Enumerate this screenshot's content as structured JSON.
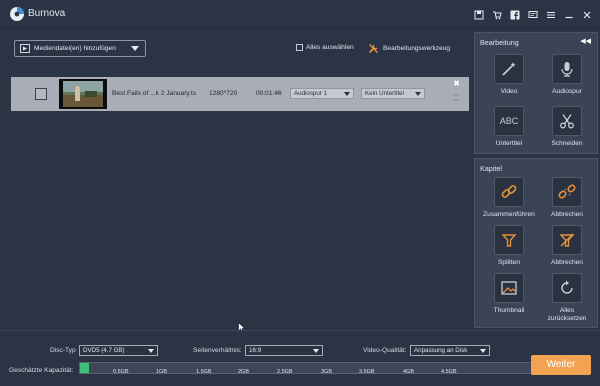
{
  "app": {
    "title": "Burnova"
  },
  "titlebar_icons": [
    "save-icon",
    "shopping-cart-icon",
    "facebook-icon",
    "feedback-icon",
    "menu-icon",
    "minimize-icon",
    "close-icon"
  ],
  "toolbar": {
    "add_media_label": "Mediendatei(en) hinzufügen",
    "select_all_label": "Alles auswählen",
    "edit_tool_label": "Bearbeitungswerkzeug"
  },
  "files": [
    {
      "name": "Best Fails of ...k 2 January.ts",
      "resolution": "1280*720",
      "duration": "00:01:46",
      "audio_track": "Audiospur 1",
      "subtitle": "Kein Untertitel",
      "close_glyph": "✖"
    }
  ],
  "sidebar": {
    "edit_section": {
      "title": "Bearbeitung",
      "collapse_glyph": "◀◀",
      "tools": [
        {
          "label": "Video",
          "icon": "magic-wand-icon"
        },
        {
          "label": "Audiospur",
          "icon": "microphone-icon"
        },
        {
          "label": "Untertitel",
          "icon": "abc-text-icon",
          "glyph": "ABC"
        },
        {
          "label": "Schneiden",
          "icon": "scissors-icon"
        }
      ]
    },
    "chapter_section": {
      "title": "Kapitel",
      "tools": [
        {
          "label": "Zusammenführen",
          "icon": "merge-link-icon"
        },
        {
          "label": "Abbrechen",
          "icon": "unlink-icon"
        },
        {
          "label": "Splitten",
          "icon": "split-icon"
        },
        {
          "label": "Abbrechen",
          "icon": "cancel-split-icon"
        },
        {
          "label": "Thumbnail",
          "icon": "thumbnail-icon"
        },
        {
          "label": "Alles zurücksetzen",
          "icon": "reset-icon"
        }
      ]
    }
  },
  "bottom": {
    "disc_type_label": "Disc-Typ",
    "disc_type_value": "DVD5 (4.7 GB)",
    "aspect_label": "Seitenverhältnis:",
    "aspect_value": "16:9",
    "quality_label": "Video-Qualität:",
    "quality_value": "Anpassung an Disk",
    "capacity_label": "Geschätzte Kapazität:",
    "capacity_used_fraction": 0.02,
    "capacity_ticks": [
      "0.5GB",
      "1GB",
      "1.5GB",
      "2GB",
      "2.5GB",
      "3GB",
      "3.5GB",
      "4GB",
      "4.5GB"
    ],
    "next_label": "Weiter"
  },
  "colors": {
    "accent": "#f2a250",
    "capacity_fill": "#3cbf79",
    "icon_orange": "#e8913a"
  }
}
